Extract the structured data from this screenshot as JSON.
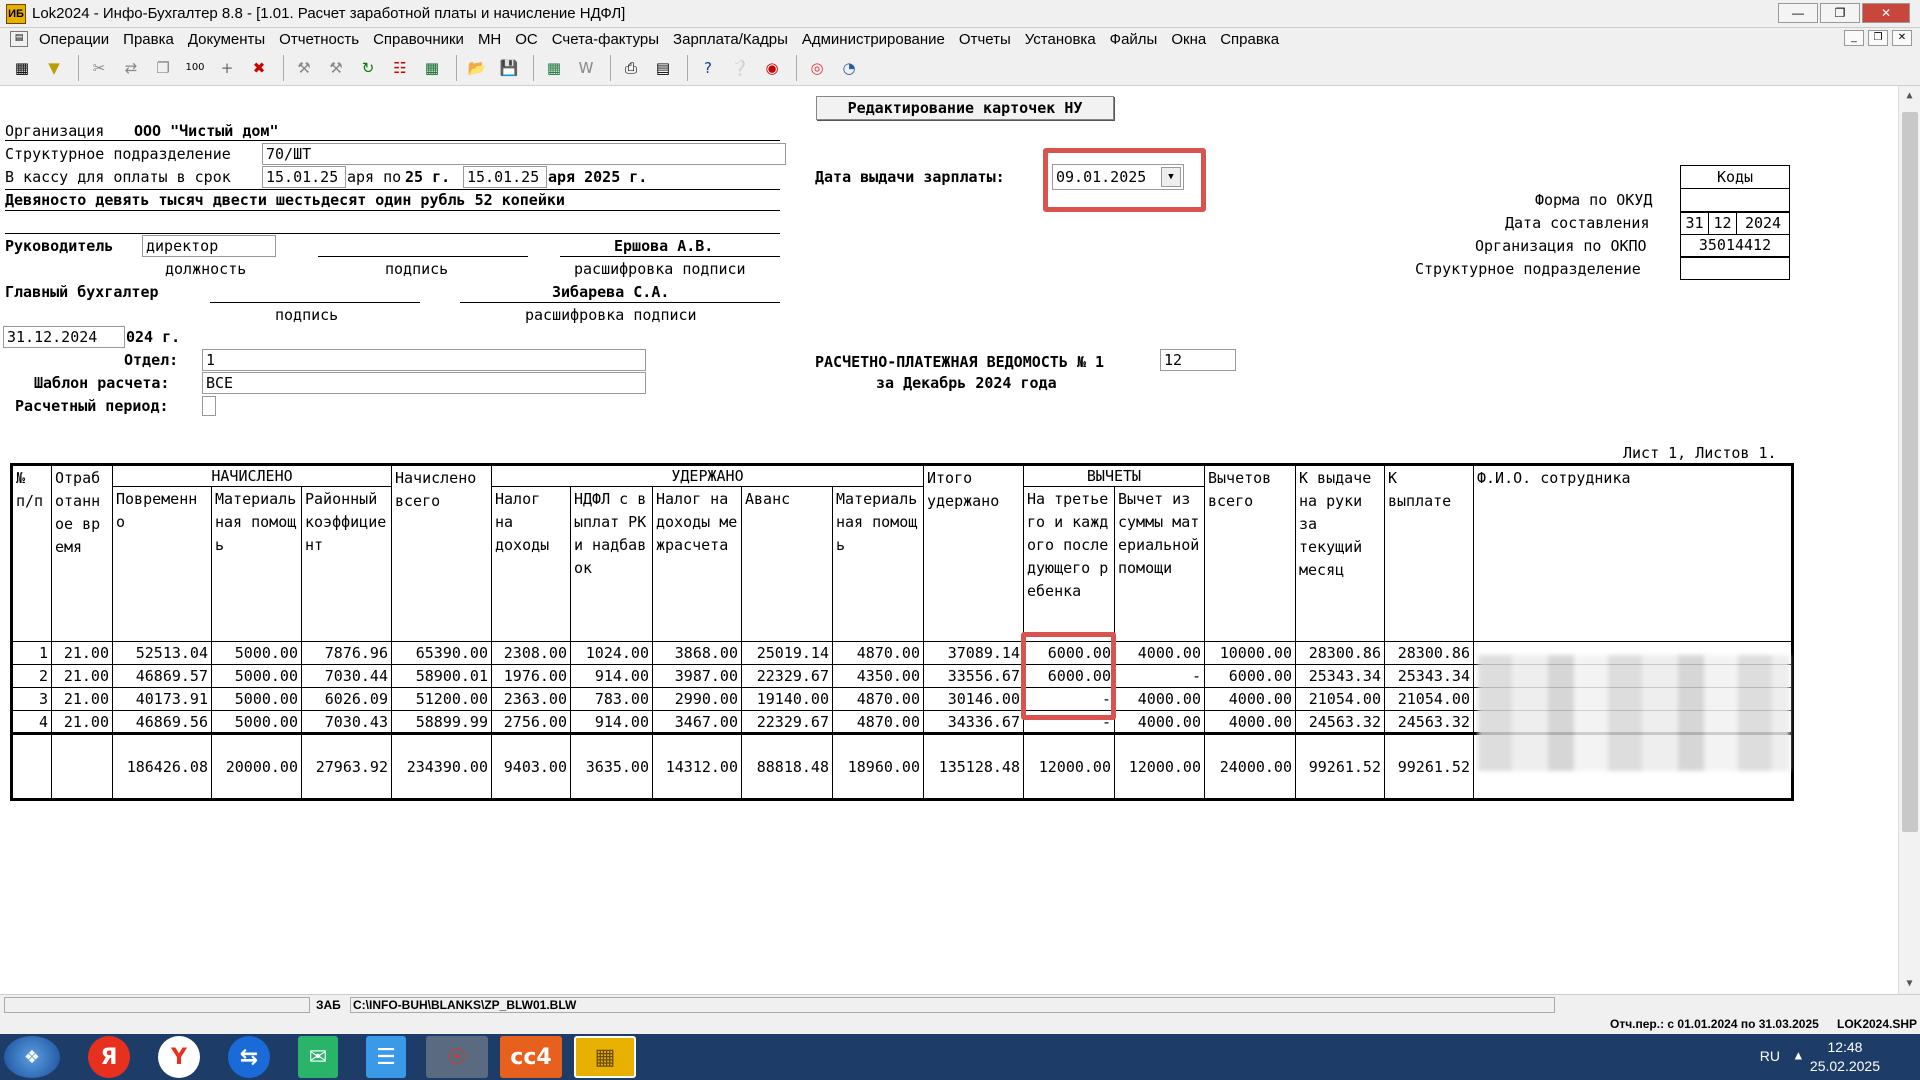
{
  "window": {
    "title": "Lok2024 - Инфо-Бухгалтер 8.8 - [1.01. Расчет заработной платы и начисление НДФЛ]",
    "icon": "app-icon"
  },
  "menu": [
    "Операции",
    "Правка",
    "Документы",
    "Отчетность",
    "Справочники",
    "МН",
    "ОС",
    "Счета-фактуры",
    "Зарплата/Кадры",
    "Администрирование",
    "Отчеты",
    "Установка",
    "Файлы",
    "Окна",
    "Справка"
  ],
  "edit_button": "Редактирование карточек НУ",
  "org_label": "Организация",
  "org_value": "ООО \"Чистый дом\"",
  "struct_label": "Структурное подразделение",
  "struct_value": "70/ШТ",
  "cash_label": "В кассу для оплаты в срок",
  "cash_from": "15.01.25",
  "cash_mid1": "аря по",
  "cash_mid2": "25 г.",
  "cash_to": "15.01.25",
  "cash_tail": "аря 2025 г.",
  "amount_words": "Девяносто девять тысяч двести шестьдесят один рубль 52 копейки",
  "pay_date_label": "Дата выдачи зарплаты:",
  "pay_date_value": "09.01.2025",
  "head_label": "Руководитель",
  "head_position": "директор",
  "head_name": "Ершова А.В.",
  "cap_position": "должность",
  "cap_sign": "подпись",
  "cap_decode": "расшифровка подписи",
  "accountant_label": "Главный бухгалтер",
  "accountant_name": "Зибарева С.А.",
  "doc_date": "31.12.2024",
  "doc_date_tail": "024 г.",
  "dept_label": "Отдел:",
  "dept_value": "1",
  "template_label": "Шаблон расчета:",
  "template_value": "ВСЕ",
  "period_label": "Расчетный период:",
  "codes": {
    "header": "Коды",
    "okud_label": "Форма по ОКУД",
    "okud_value": "",
    "date_label": "Дата составления",
    "date_d": "31",
    "date_m": "12",
    "date_y": "2024",
    "okpo_label": "Организация по ОКПО",
    "okpo_value": "35014412",
    "sub_label": "Структурное подразделение",
    "sub_value": ""
  },
  "statement_title": "РАСЧЕТНО-ПЛАТЕЖНАЯ ВЕДОМОСТЬ №",
  "statement_digit": "1",
  "statement_number": "12",
  "statement_period": "за Декабрь 2024 года",
  "sheet_info": "Лист 1, Листов 1.",
  "table": {
    "h_no": "№ п/п",
    "h_time": "Отработанное время",
    "h_accrued": "НАЧИСЛЕНО",
    "h_time_pay": "Повременно",
    "h_mat": "Материальная помощь",
    "h_coef": "Районный коэффициент",
    "h_accrued_total": "Начислено всего",
    "h_withheld": "УДЕРЖАНО",
    "h_tax": "Налог на доходы",
    "h_ndfl": "НДФЛ с выплат РК и надбавок",
    "h_tax_inter": "Налог на доходы межрасчета",
    "h_advance": "Аванс",
    "h_mat2": "Материальная помощь",
    "h_withheld_total": "Итого удержано",
    "h_ded": "ВЫЧЕТЫ",
    "h_ded_child": "На третьего и каждого последующего ребенка",
    "h_ded_mat": "Вычет из суммы материальной помощи",
    "h_ded_total": "Вычетов всего",
    "h_to_pay_month": "К выдаче на руки за текущий месяц",
    "h_to_pay": "К выплате",
    "h_fio": "Ф.И.О. сотрудника",
    "rows": [
      [
        "1",
        "21.00",
        "52513.04",
        "5000.00",
        "7876.96",
        "65390.00",
        "2308.00",
        "1024.00",
        "3868.00",
        "25019.14",
        "4870.00",
        "37089.14",
        "6000.00",
        "4000.00",
        "10000.00",
        "28300.86",
        "28300.86"
      ],
      [
        "2",
        "21.00",
        "46869.57",
        "5000.00",
        "7030.44",
        "58900.01",
        "1976.00",
        "914.00",
        "3987.00",
        "22329.67",
        "4350.00",
        "33556.67",
        "6000.00",
        "-",
        "6000.00",
        "25343.34",
        "25343.34"
      ],
      [
        "3",
        "21.00",
        "40173.91",
        "5000.00",
        "6026.09",
        "51200.00",
        "2363.00",
        "783.00",
        "2990.00",
        "19140.00",
        "4870.00",
        "30146.00",
        "-",
        "4000.00",
        "4000.00",
        "21054.00",
        "21054.00"
      ],
      [
        "4",
        "21.00",
        "46869.56",
        "5000.00",
        "7030.43",
        "58899.99",
        "2756.00",
        "914.00",
        "3467.00",
        "22329.67",
        "4870.00",
        "34336.67",
        "-",
        "4000.00",
        "4000.00",
        "24563.32",
        "24563.32"
      ]
    ],
    "totals": [
      "",
      "",
      "186426.08",
      "20000.00",
      "27963.92",
      "234390.00",
      "9403.00",
      "3635.00",
      "14312.00",
      "88818.48",
      "18960.00",
      "135128.48",
      "12000.00",
      "12000.00",
      "24000.00",
      "99261.52",
      "99261.52"
    ]
  },
  "status": {
    "zab": "ЗАБ",
    "path": "C:\\INFO-BUH\\BLANKS\\ZP_BLW01.BLW",
    "period": "Отч.пер.: с 01.01.2024 по 31.03.2025",
    "file": "LOK2024.SHP"
  },
  "taskbar": {
    "lang": "RU",
    "time": "12:48",
    "date": "25.02.2025"
  }
}
